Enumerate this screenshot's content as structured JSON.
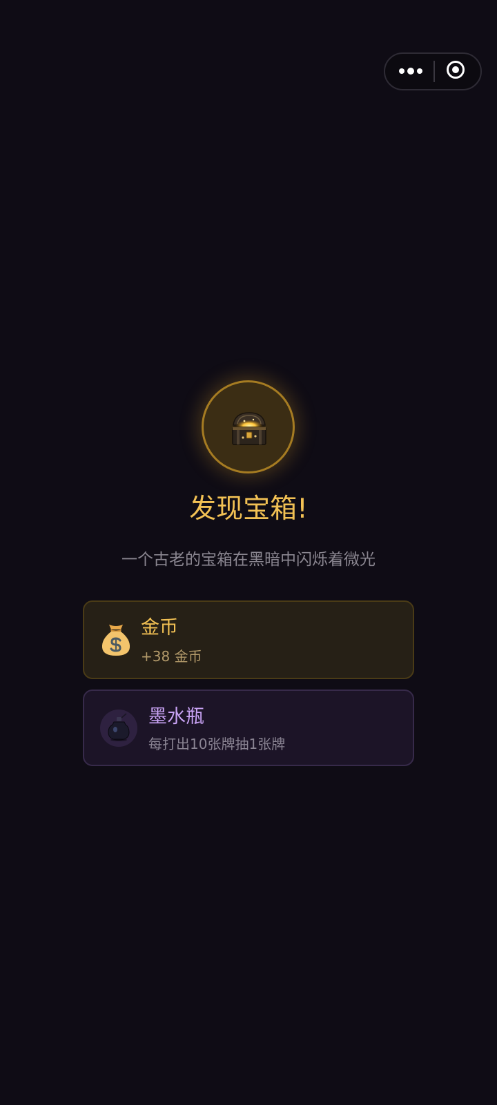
{
  "menu_capsule": {
    "more_icon": "more-dots-icon",
    "close_icon": "target-circle-icon"
  },
  "chest": {
    "icon": "treasure-chest-icon"
  },
  "title": "发现宝箱!",
  "subtitle": "一个古老的宝箱在黑暗中闪烁着微光",
  "rewards": [
    {
      "name": "金币",
      "description": "+38 金币",
      "icon": "money-bag-icon"
    },
    {
      "name": "墨水瓶",
      "description": "每打出10张牌抽1张牌",
      "icon": "ink-bottle-icon"
    }
  ],
  "colors": {
    "background": "#0f0c15",
    "gold_accent": "#f2c154",
    "purple_accent": "#c9a3f5"
  }
}
